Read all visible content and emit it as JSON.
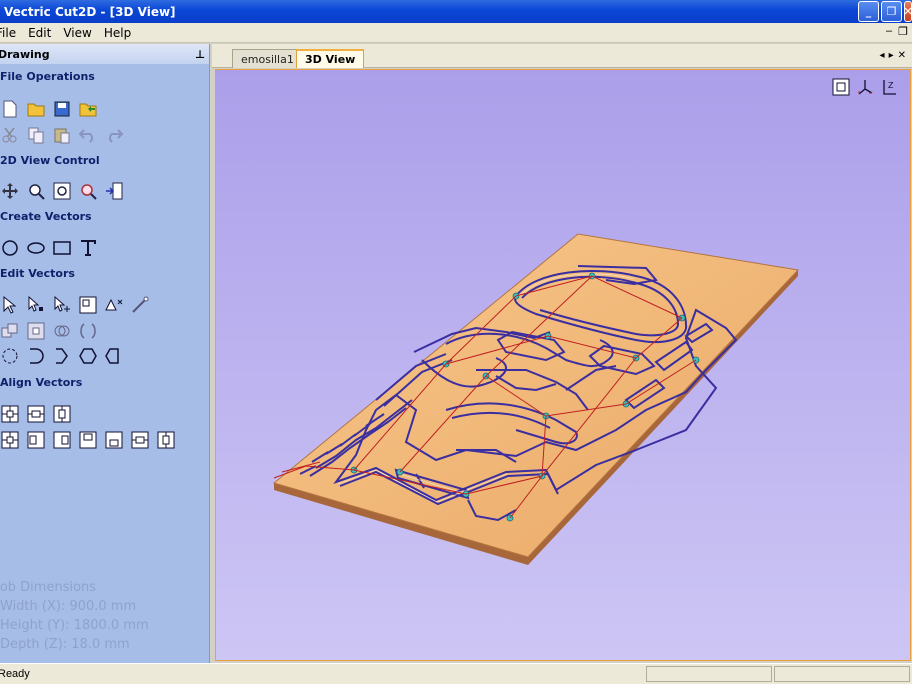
{
  "window": {
    "title": "Vectric Cut2D - [3D View]"
  },
  "menu": [
    "File",
    "Edit",
    "View",
    "Help"
  ],
  "panel": {
    "title": "Drawing",
    "pin": "⊥",
    "sections": [
      {
        "title": "File Operations"
      },
      {
        "title": "2D View Control"
      },
      {
        "title": "Create Vectors"
      },
      {
        "title": "Edit Vectors"
      },
      {
        "title": "Align Vectors"
      }
    ],
    "job_dimensions": {
      "heading": "Job Dimensions",
      "width": "Width  (X): 900.0 mm",
      "height": "Height (Y): 1800.0 mm",
      "depth": "Depth  (Z): 18.0 mm"
    }
  },
  "tabs": [
    {
      "label": "emosilla1",
      "active": false
    },
    {
      "label": "3D View",
      "active": true
    }
  ],
  "status": {
    "text": "Ready"
  },
  "colors": {
    "accent": "#0a46d6",
    "panel": "#a6bde8",
    "viewport_bg": "#b3a8ee",
    "board": "#f0b678",
    "toolpath": "#3a2ea0",
    "rapid": "#c02020"
  }
}
